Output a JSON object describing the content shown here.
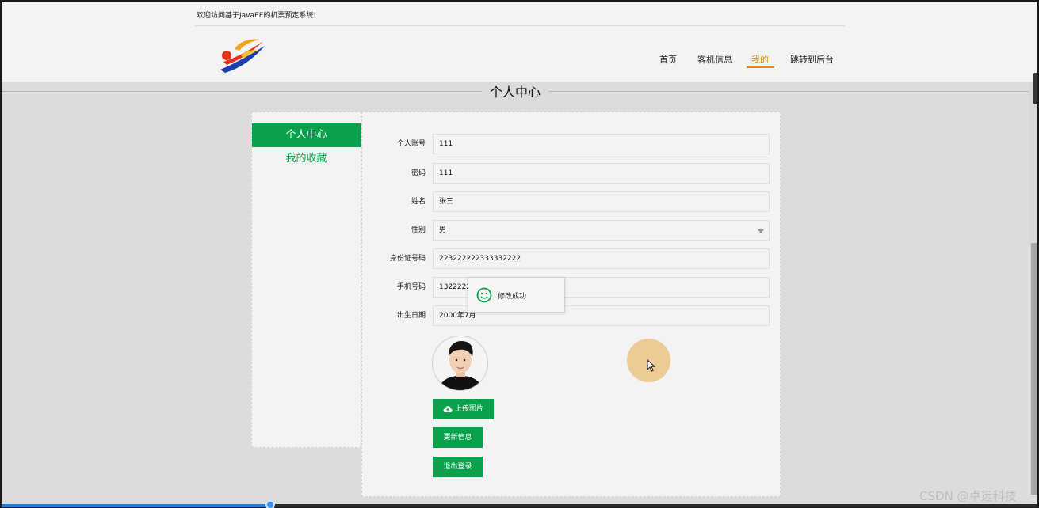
{
  "header": {
    "welcome": "欢迎访问基于JavaEE的机票预定系统!",
    "nav": [
      {
        "label": "首页",
        "active": false
      },
      {
        "label": "客机信息",
        "active": false
      },
      {
        "label": "我的",
        "active": true
      },
      {
        "label": "跳转到后台",
        "active": false
      }
    ]
  },
  "section_title": "个人中心",
  "sidebar": {
    "items": [
      {
        "label": "个人中心",
        "active": true
      },
      {
        "label": "我的收藏",
        "active": false
      }
    ]
  },
  "form": {
    "fields": [
      {
        "label": "个人账号",
        "value": "111"
      },
      {
        "label": "密码",
        "value": "111"
      },
      {
        "label": "姓名",
        "value": "张三"
      },
      {
        "label": "性别",
        "value": "男"
      },
      {
        "label": "身份证号码",
        "value": "223222222333332222"
      },
      {
        "label": "手机号码",
        "value": "1322222"
      },
      {
        "label": "出生日期",
        "value": "2000年7月"
      }
    ]
  },
  "buttons": {
    "upload": "上传图片",
    "update": "更新信息",
    "logout": "退出登录"
  },
  "toast": {
    "message": "修改成功"
  },
  "player": {
    "progress": 0.26
  },
  "watermark": "CSDN @卓远科技",
  "colors": {
    "accent_green": "#0aa14c",
    "nav_active": "#d98f0a",
    "page_bg": "#dcdcdd",
    "panel_bg": "#f3f3f3"
  }
}
